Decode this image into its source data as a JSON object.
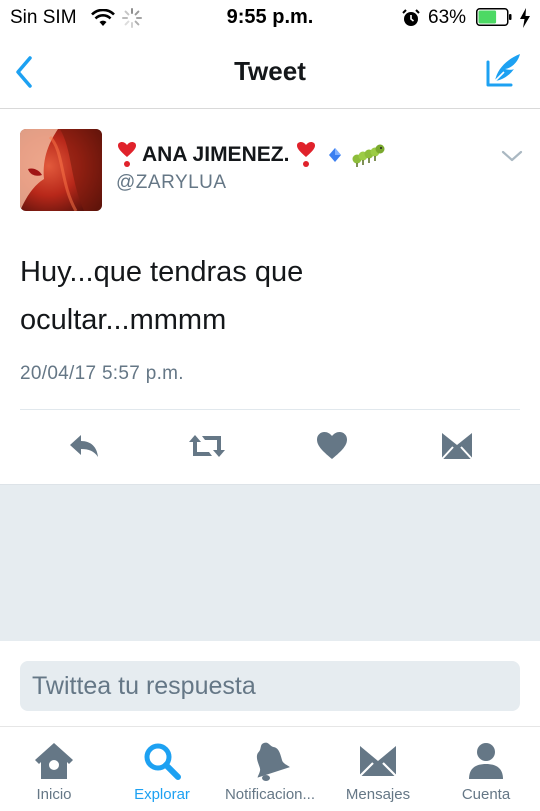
{
  "status_bar": {
    "carrier": "Sin SIM",
    "time": "9:55 p.m.",
    "battery_percent": "63%",
    "battery_level": 0.63
  },
  "nav": {
    "title": "Tweet",
    "back_icon": "chevron-left-icon",
    "compose_icon": "compose-icon"
  },
  "tweet": {
    "display_name": "ANA JIMENEZ.",
    "handle": "@ZARYLUA",
    "text_line1": "Huy...que tendras que",
    "text_line2": "ocultar...mmmm",
    "timestamp": "20/04/17 5:57 p.m."
  },
  "actions": {
    "reply_icon": "reply-icon",
    "retweet_icon": "retweet-icon",
    "like_icon": "heart-icon",
    "dm_icon": "envelope-icon"
  },
  "reply": {
    "placeholder": "Twittea tu respuesta"
  },
  "tabs": [
    {
      "label": "Inicio",
      "icon": "home-icon"
    },
    {
      "label": "Explorar",
      "icon": "search-icon",
      "active": true
    },
    {
      "label": "Notificacion...",
      "icon": "bell-icon"
    },
    {
      "label": "Mensajes",
      "icon": "envelope-icon"
    },
    {
      "label": "Cuenta",
      "icon": "person-icon"
    }
  ],
  "colors": {
    "accent": "#1da1f2",
    "icon_gray": "#657786",
    "background_gray": "#e6ecf0",
    "battery_green": "#4cd964"
  }
}
